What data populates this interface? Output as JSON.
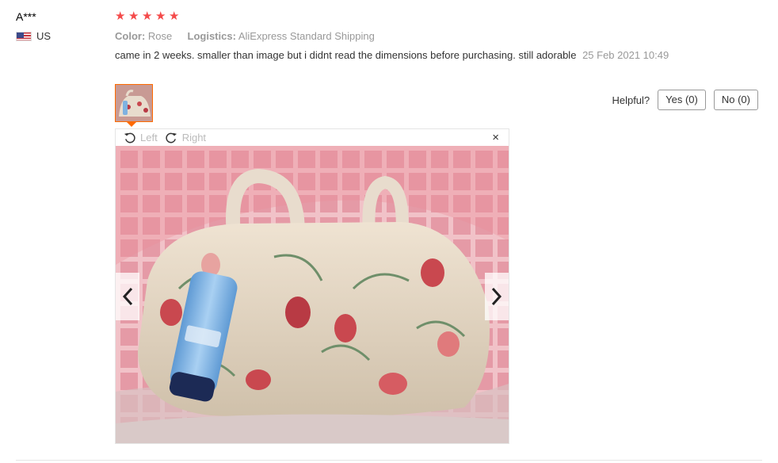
{
  "user": {
    "name": "A***",
    "country": "US",
    "flag_icon": "us-flag-icon"
  },
  "review": {
    "rating": 5,
    "star_color": "#f44a4a",
    "color_label": "Color:",
    "color_value": "Rose",
    "logistics_label": "Logistics:",
    "logistics_value": "AliExpress Standard Shipping",
    "text": "came in 2 weeks. smaller than image but i didnt read the dimensions before purchasing. still adorable",
    "date": "25 Feb 2021 10:49"
  },
  "helpful": {
    "label": "Helpful?",
    "yes": "Yes (0)",
    "no": "No (0)"
  },
  "viewer": {
    "rotate_left": "Left",
    "rotate_right": "Right",
    "close": "×"
  },
  "colors": {
    "accent": "#ff6a00"
  }
}
